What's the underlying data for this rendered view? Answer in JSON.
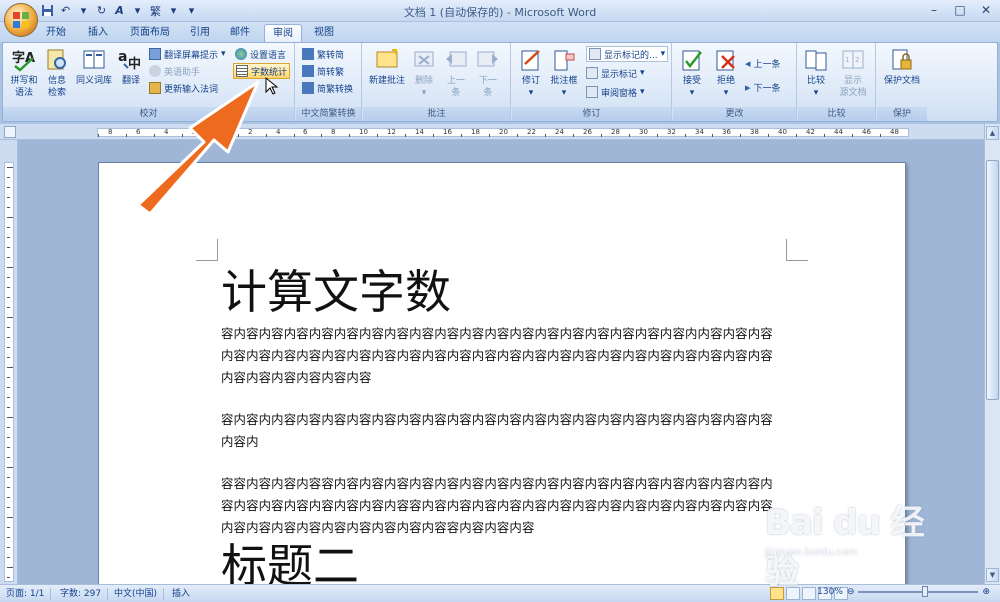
{
  "window": {
    "title": "文档 1 (自动保存的) - Microsoft Word",
    "min": "–",
    "max": "□",
    "close": "✕"
  },
  "qat": {
    "undo": "↶",
    "redo": "↻",
    "format": "A",
    "traditional": "繁",
    "more": "▾"
  },
  "tabs": [
    "开始",
    "插入",
    "页面布局",
    "引用",
    "邮件",
    "审阅",
    "视图"
  ],
  "ribbon": {
    "proofing": {
      "label": "校对",
      "spelling": "拼写和\n语法",
      "research": "信息\n检索",
      "thesaurus": "同义词库",
      "translate": "翻译",
      "translate_tip": "翻译屏幕提示",
      "english_assistant": "英语助手",
      "update_ime": "更新输入法词",
      "set_language": "设置语言",
      "word_count": "字数统计"
    },
    "chinese": {
      "label": "中文简繁转换",
      "to_simplified": "繁转简",
      "to_traditional": "简转繁",
      "convert": "简繁转换"
    },
    "comments": {
      "label": "批注",
      "new": "新建批注",
      "delete": "删除",
      "prev": "上一\n条",
      "next": "下一\n条"
    },
    "tracking": {
      "label": "修订",
      "track": "修订",
      "balloons": "批注框",
      "display": "显示标记的...",
      "show_markup": "显示标记",
      "pane": "审阅窗格"
    },
    "changes": {
      "label": "更改",
      "accept": "接受",
      "reject": "拒绝",
      "prev": "上一条",
      "next": "下一条"
    },
    "compare": {
      "label": "比较",
      "compare": "比较",
      "show_source": "显示\n源文档"
    },
    "protect": {
      "label": "保护",
      "protect_doc": "保护文档"
    }
  },
  "document": {
    "title": "计算文字数",
    "paragraphs": [
      "容内容内容内容内容内容内容内容内容内容内容内容内容内容内容内容内容内容内容内内容内容内容内容内容内容内容内容内容内容内容内容内容内容内容内容内容内容内容内容内容内容内容内容内容内容内容内容内容内容内容",
      "容内容内内容内容内容内容内容内容内容内容内容内容内容内容内容内容内容内容内容内容内容内容内容内",
      "容容内容内容内容容内容内容内容内容内容内容内容内容内容内容内容内容内容内容内容内容内容内容内容内容内容内容内容内容内容容内容内容内容内容内容内容内容内容内容内容内容内容内容内容内容内容内容内容内容内容内容内容内容容内容内容内容"
    ],
    "heading2": "标题二"
  },
  "status": {
    "page": "页面: 1/1",
    "words": "字数: 297",
    "lang": "中文(中国)",
    "insert": "插入",
    "zoom": "130%"
  },
  "ruler": {
    "h_numbers": [
      "8",
      "6",
      "4",
      "2",
      "",
      "2",
      "4",
      "6",
      "8",
      "10",
      "12",
      "14",
      "16",
      "18",
      "20",
      "22",
      "24",
      "26",
      "28",
      "30",
      "32",
      "34",
      "36",
      "38",
      "40",
      "42",
      "44",
      "46",
      "48"
    ]
  },
  "watermark": {
    "logo": "Bai du 经验",
    "sub": "jingyan.baidu.com"
  },
  "colors": {
    "accent": "#15428b",
    "arrow": "#ee6a1e",
    "ribbon": "#dfeaf8"
  }
}
